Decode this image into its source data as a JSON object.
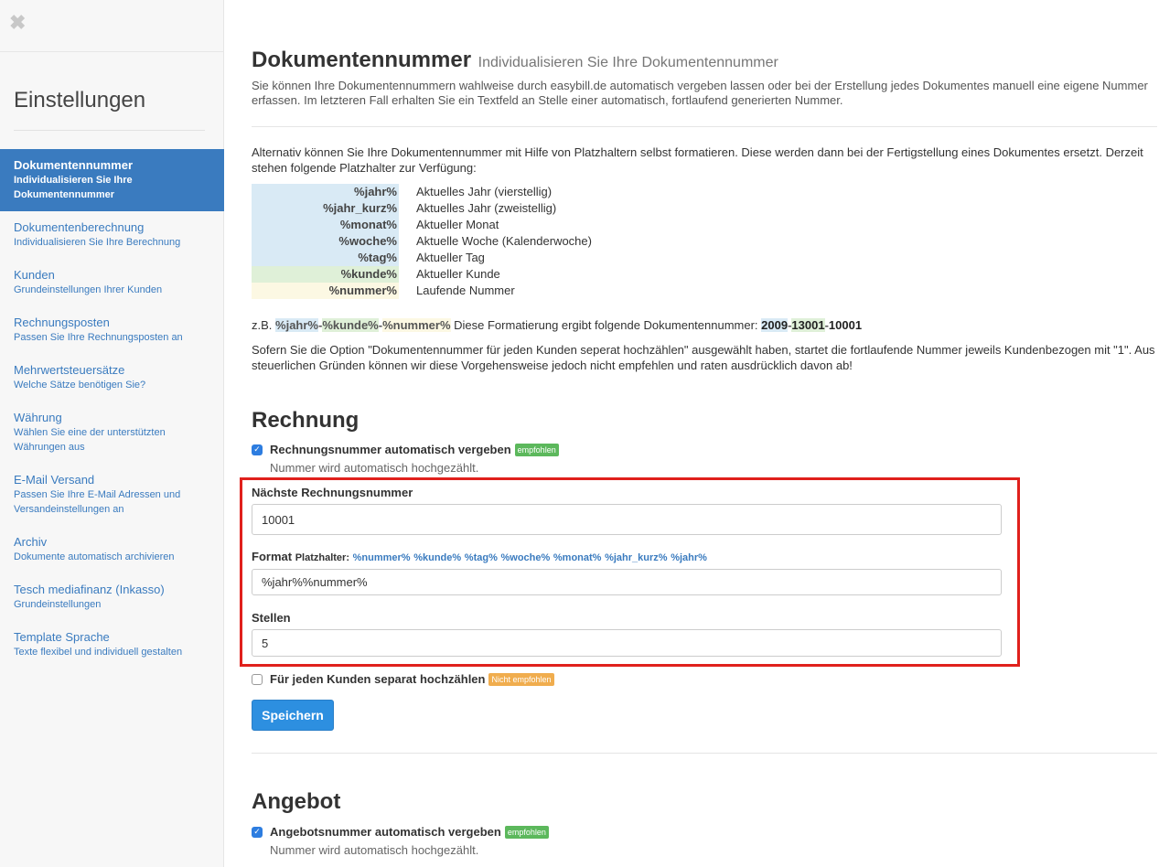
{
  "sidebar": {
    "close_label": "✖",
    "title": "Einstellungen",
    "items": [
      {
        "title": "Dokumentennummer",
        "subtitle": "Individualisieren Sie Ihre Dokumentennummer"
      },
      {
        "title": "Dokumentenberechnung",
        "subtitle": "Individualisieren Sie Ihre Berechnung"
      },
      {
        "title": "Kunden",
        "subtitle": "Grundeinstellungen Ihrer Kunden"
      },
      {
        "title": "Rechnungsposten",
        "subtitle": "Passen Sie Ihre Rechnungsposten an"
      },
      {
        "title": "Mehrwertsteuersätze",
        "subtitle": "Welche Sätze benötigen Sie?"
      },
      {
        "title": "Währung",
        "subtitle": "Wählen Sie eine der unterstützten Währungen aus"
      },
      {
        "title": "E-Mail Versand",
        "subtitle": "Passen Sie Ihre E-Mail Adressen und Versandeinstellungen an"
      },
      {
        "title": "Archiv",
        "subtitle": "Dokumente automatisch archivieren"
      },
      {
        "title": "Tesch mediafinanz (Inkasso)",
        "subtitle": "Grundeinstellungen"
      },
      {
        "title": "Template Sprache",
        "subtitle": "Texte flexibel und individuell gestalten"
      }
    ]
  },
  "main": {
    "title": "Dokumentennummer",
    "title_sub": "Individualisieren Sie Ihre Dokumentennummer",
    "intro": "Sie können Ihre Dokumentennummern wahlweise durch easybill.de automatisch vergeben lassen oder bei der Erstellung jedes Dokumentes manuell eine eigene Nummer erfassen. Im letzteren Fall erhalten Sie ein Textfeld an Stelle einer automatisch, fortlaufend generierten Nummer.",
    "alt_text": "Alternativ können Sie Ihre Dokumentennummer mit Hilfe von Platzhaltern selbst formatieren. Diese werden dann bei der Fertigstellung eines Dokumentes ersetzt. Derzeit stehen folgende Platzhalter zur Verfügung:",
    "placeholders": [
      {
        "key": "%jahr%",
        "desc": "Aktuelles Jahr (vierstellig)"
      },
      {
        "key": "%jahr_kurz%",
        "desc": "Aktuelles Jahr (zweistellig)"
      },
      {
        "key": "%monat%",
        "desc": "Aktueller Monat"
      },
      {
        "key": "%woche%",
        "desc": "Aktuelle Woche (Kalenderwoche)"
      },
      {
        "key": "%tag%",
        "desc": "Aktueller Tag"
      },
      {
        "key": "%kunde%",
        "desc": "Aktueller Kunde"
      },
      {
        "key": "%nummer%",
        "desc": "Laufende Nummer"
      }
    ],
    "example": {
      "prefix": "z.B.",
      "p1": "%jahr%",
      "dash": "-",
      "p2": "%kunde%",
      "p3": "%nummer%",
      "middle": "Diese Formatierung ergibt folgende Dokumentennummer:",
      "r1": "2009",
      "r2": "13001",
      "r3": "10001"
    },
    "note": "Sofern Sie die Option \"Dokumentennummer für jeden Kunden seperat hochzählen\" ausgewählt haben, startet die fortlaufende Nummer jeweils Kundenbezogen mit \"1\". Aus steuerlichen Gründen können wir diese Vorgehensweise jedoch nicht empfehlen und raten ausdrücklich davon ab!"
  },
  "rechnung": {
    "heading": "Rechnung",
    "auto_label": "Rechnungsnummer automatisch vergeben",
    "auto_badge": "empfohlen",
    "auto_help": "Nummer wird automatisch hochgezählt.",
    "next_label": "Nächste Rechnungsnummer",
    "next_value": "10001",
    "format_label": "Format",
    "format_sub": "Platzhalter:",
    "format_placeholders": [
      "%nummer%",
      "%kunde%",
      "%tag%",
      "%woche%",
      "%monat%",
      "%jahr_kurz%",
      "%jahr%"
    ],
    "format_value": "%jahr%%nummer%",
    "digits_label": "Stellen",
    "digits_value": "5",
    "separate_label": "Für jeden Kunden separat hochzählen",
    "separate_badge": "Nicht empfohlen",
    "save_label": "Speichern"
  },
  "angebot": {
    "heading": "Angebot",
    "auto_label": "Angebotsnummer automatisch vergeben",
    "auto_badge": "empfohlen",
    "auto_help": "Nummer wird automatisch hochgezählt."
  },
  "colors": {
    "accent": "#3a7bbf",
    "highlight_box": "#e0201c",
    "badge_green": "#5cb85c",
    "badge_orange": "#f0ad4e"
  }
}
